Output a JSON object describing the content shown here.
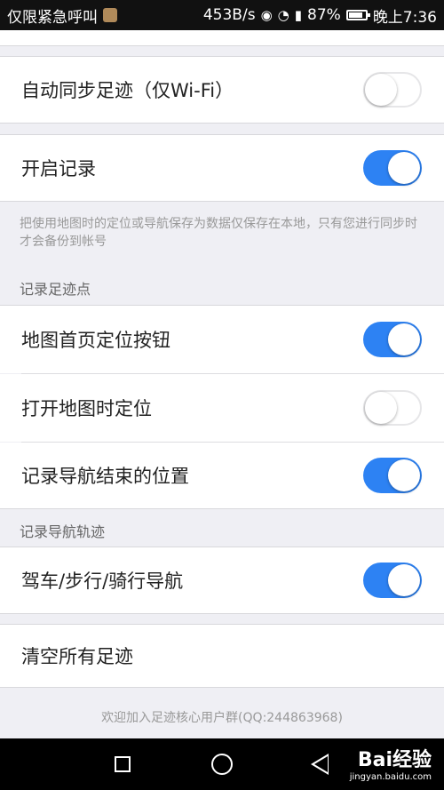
{
  "status_bar": {
    "emergency_text": "仅限紧急呼叫",
    "network_speed": "453B/s",
    "battery_percent": "87%",
    "time": "晚上7:36"
  },
  "settings": {
    "auto_sync": {
      "label": "自动同步足迹（仅Wi-Fi）",
      "enabled": false
    },
    "enable_record": {
      "label": "开启记录",
      "enabled": true
    },
    "record_note": "把使用地图时的定位或导航保存为数据仅保存在本地，只有您进行同步时才会备份到帐号",
    "section_points": "记录足迹点",
    "map_home_locate": {
      "label": "地图首页定位按钮",
      "enabled": true
    },
    "open_map_locate": {
      "label": "打开地图时定位",
      "enabled": false
    },
    "nav_end_position": {
      "label": "记录导航结束的位置",
      "enabled": true
    },
    "section_tracks": "记录导航轨迹",
    "drive_walk_ride": {
      "label": "驾车/步行/骑行导航",
      "enabled": true
    },
    "clear_all": {
      "label": "清空所有足迹"
    }
  },
  "footer": {
    "text": "欢迎加入足迹核心用户群(QQ:244863968)"
  },
  "nav_bar": {
    "watermark_main": "Bai经验",
    "watermark_sub": "jingyan.baidu.com"
  },
  "colors": {
    "toggle_on": "#2d82f3",
    "background": "#efeff4"
  }
}
